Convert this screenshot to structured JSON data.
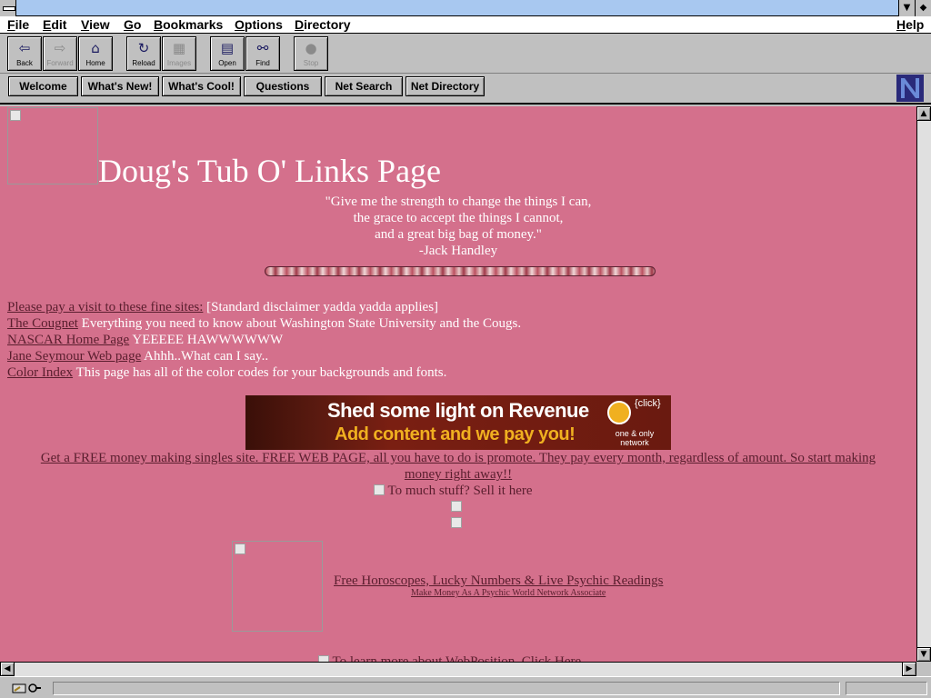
{
  "menu": [
    "File",
    "Edit",
    "View",
    "Go",
    "Bookmarks",
    "Options",
    "Directory"
  ],
  "menu_help": "Help",
  "toolbar": {
    "back": "Back",
    "forward": "Forward",
    "home": "Home",
    "reload": "Reload",
    "images": "Images",
    "open": "Open",
    "find": "Find",
    "stop": "Stop"
  },
  "directory_buttons": [
    "Welcome",
    "What's New!",
    "What's Cool!",
    "Questions",
    "Net Search",
    "Net Directory"
  ],
  "page": {
    "title": "Doug's Tub O' Links Page",
    "quote_lines": [
      "\"Give me the strength to change the things I can,",
      "the grace to accept the things I cannot,",
      "and a great big bag of money.\"",
      "-Jack Handley"
    ],
    "visit_link": "Please pay a visit to these fine sites:",
    "disclaimer": "[Standard disclaimer yadda yadda applies]",
    "links": [
      {
        "label": "The Cougnet",
        "desc": "Everything you need to know about Washington State University and the Cougs."
      },
      {
        "label": "NASCAR Home Page",
        "desc": "YEEEEE HAWWWWWW"
      },
      {
        "label": "Jane Seymour Web page",
        "desc": "Ahhh..What can I say.."
      },
      {
        "label": "Color Index",
        "desc": "This page has all of the color codes for your backgrounds and fonts."
      }
    ],
    "banner": {
      "line1": "Shed some light on Revenue",
      "line2": "Add content and we pay you!",
      "click": "{click}",
      "network_line1": "one & only",
      "network_line2": "network"
    },
    "free_site_line1": "Get a FREE money making singles site. FREE WEB PAGE, all you have to do is promote. They pay every month, regardless of amount. So start making",
    "free_site_line2": "money right away!!",
    "sell_alt": "To much stuff? Sell it here",
    "horoscope_link": "Free Horoscopes, Lucky Numbers & Live Psychic Readings",
    "psychic_associate": "Make Money As A Psychic World Network Associate",
    "webposition_alt": "To learn more about WebPosition, Click Here"
  },
  "colors": {
    "page_background": "#d4708c",
    "link": "#5a1e2e",
    "text": "#ffffff",
    "title_bar": "#a8c8f0",
    "chrome": "#c0c0c0"
  }
}
